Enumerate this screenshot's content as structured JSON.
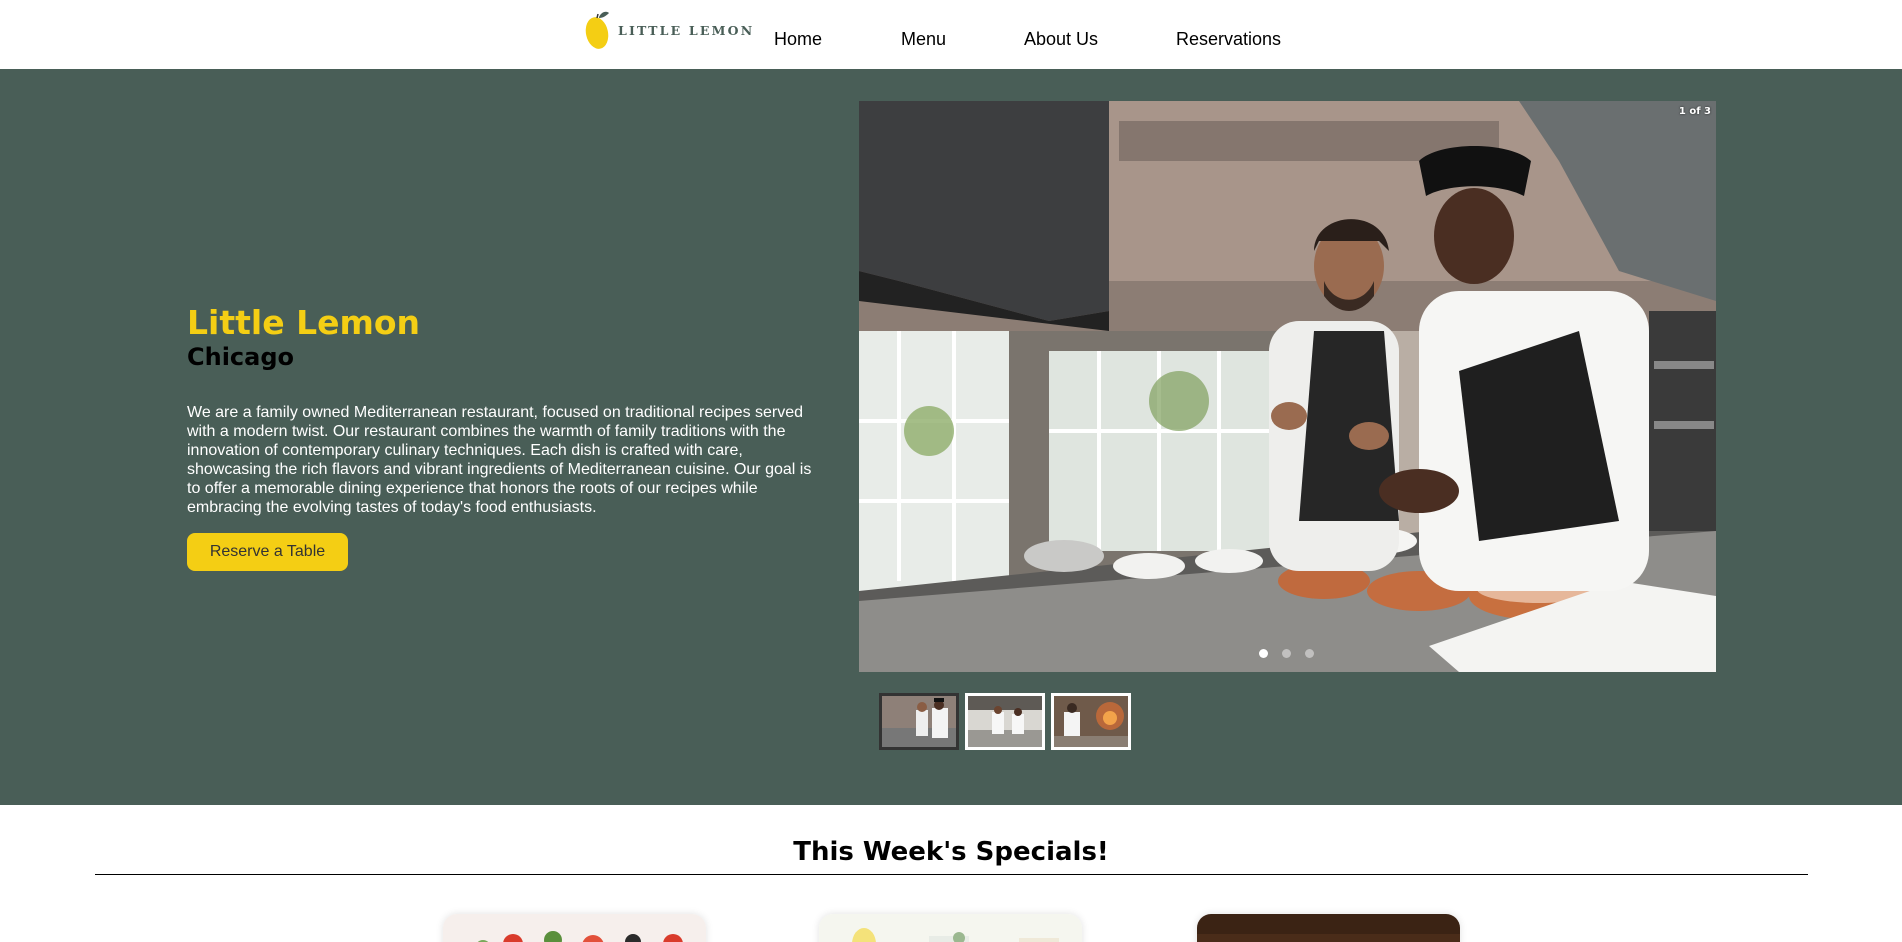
{
  "brand": {
    "name": "LITTLE LEMON",
    "icon": "lemon-logo-icon",
    "color_green": "#495e57",
    "color_yellow": "#f4ce14"
  },
  "nav": {
    "items": [
      {
        "label": "Home"
      },
      {
        "label": "Menu"
      },
      {
        "label": "About Us"
      },
      {
        "label": "Reservations"
      }
    ]
  },
  "hero": {
    "title": "Little Lemon",
    "subtitle": "Chicago",
    "description": "We are a family owned Mediterranean restaurant, focused on traditional recipes served with a modern twist. Our restaurant combines the warmth of family traditions with the innovation of contemporary culinary techniques. Each dish is crafted with care, showcasing the rich flavors and vibrant ingredients of Mediterranean cuisine. Our goal is to offer a memorable dining experience that honors the roots of our recipes while embracing the evolving tastes of today's food enthusiasts.",
    "cta_label": "Reserve a Table"
  },
  "carousel": {
    "counter": "1 of 3",
    "current_slide": 1,
    "total_slides": 3,
    "slide_alt": "Two chefs talking in a restaurant kitchen"
  },
  "specials": {
    "title": "This Week's Specials!"
  }
}
